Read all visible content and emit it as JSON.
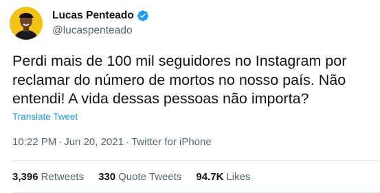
{
  "author": {
    "display_name": "Lucas Penteado",
    "handle": "@lucaspenteado",
    "verified": true,
    "avatar_icon": "avatar-photo"
  },
  "tweet": {
    "text": "Perdi mais de 100 mil seguidores no Instagram por\nreclamar do número de mortos no nosso país. Não\nentendi! A vida dessas pessoas não importa?",
    "translate_label": "Translate Tweet",
    "time": "10:22 PM",
    "date": "Jun 20, 2021",
    "source": "Twitter for iPhone",
    "separator": "·"
  },
  "stats": {
    "retweets": {
      "count": "3,396",
      "label": "Retweets"
    },
    "quote_tweets": {
      "count": "330",
      "label": "Quote Tweets"
    },
    "likes": {
      "count": "94.7K",
      "label": "Likes"
    }
  },
  "colors": {
    "link": "#1d9bf0",
    "secondary_text": "#536471",
    "verified_badge": "#1d9bf0",
    "avatar_bg": "#f2c216"
  }
}
